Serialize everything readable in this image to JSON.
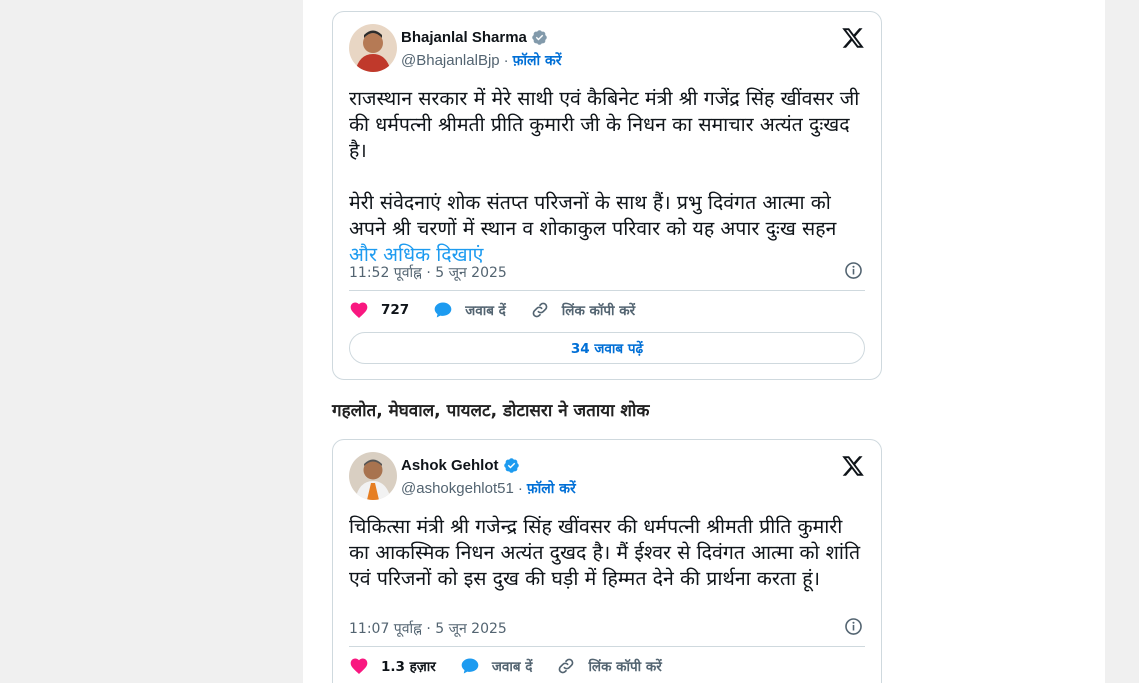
{
  "tweets": [
    {
      "author": "Bhajanlal Sharma",
      "handle": "@BhajanlalBjp",
      "separator": "·",
      "follow_label": "फ़ॉलो करें",
      "text_p1": "राजस्थान सरकार में मेरे साथी एवं कैबिनेट मंत्री श्री गजेंद्र सिंह खींवसर जी की धर्मपत्नी श्रीमती प्रीति कुमारी जी के निधन का समाचार अत्यंत दुःखद है।",
      "text_p2": "मेरी संवेदनाएं शोक संतप्त परिजनों के साथ हैं। प्रभु दिवंगत आत्मा को अपने श्री चरणों में स्थान व शोकाकुल परिवार को यह अपार दुःख सहन ",
      "show_more": "और अधिक दिखाएं",
      "timestamp": "11:52 पूर्वाह्न · 5 जून 2025",
      "likes": "727",
      "reply_label": "जवाब दें",
      "copy_link_label": "लिंक कॉपी करें",
      "read_replies": "34 जवाब पढ़ें",
      "avatar_color": "#c0392b"
    },
    {
      "author": "Ashok Gehlot",
      "handle": "@ashokgehlot51",
      "separator": "·",
      "follow_label": "फ़ॉलो करें",
      "text_p1": "चिकित्सा मंत्री श्री गजेन्द्र सिंह खींवसर की धर्मपत्नी श्रीमती प्रीति कुमारी का आकस्मिक निधन अत्यंत दुखद है। मैं ईश्वर से दिवंगत आत्मा को शांति एवं परिजनों को इस दुख की घड़ी में हिम्मत देने की प्रार्थना करता हूं।",
      "timestamp": "11:07 पूर्वाह्न · 5 जून 2025",
      "likes": "1.3 हज़ार",
      "reply_label": "जवाब दें",
      "copy_link_label": "लिंक कॉपी करें",
      "avatar_color": "#d35400"
    }
  ],
  "subheading": "गहलोत, मेघवाल, पायलट, डोटासरा ने जताया शोक",
  "colors": {
    "verified": "#1d9bf0",
    "heart": "#f91880",
    "reply_bubble": "#1d9bf0",
    "link_blue": "#006fd6"
  },
  "icons": [
    "verified-badge-icon",
    "x-logo-icon",
    "info-icon",
    "heart-icon",
    "reply-icon",
    "link-icon"
  ]
}
